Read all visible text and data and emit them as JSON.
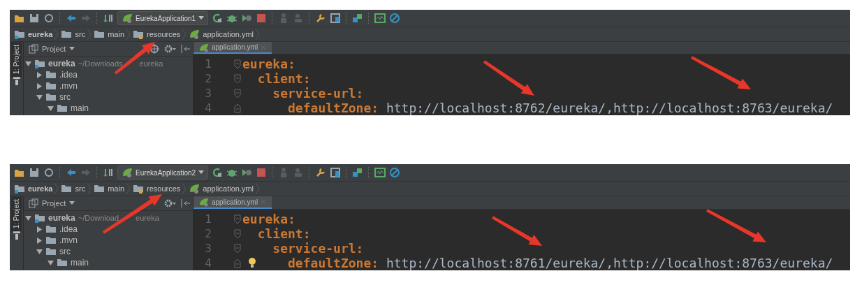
{
  "panels": [
    {
      "toolbar": {
        "run_config": "EurekaApplication1"
      },
      "breadcrumbs": [
        {
          "label": "eureka",
          "kind": "module"
        },
        {
          "label": "src",
          "kind": "folder"
        },
        {
          "label": "main",
          "kind": "folder"
        },
        {
          "label": "resources",
          "kind": "resources"
        },
        {
          "label": "application.yml",
          "kind": "yaml"
        }
      ],
      "tool_window": {
        "stripe_label": "1: Project",
        "title": "Project"
      },
      "pane_tools": [
        {
          "kind": "target"
        },
        {
          "kind": "gear"
        },
        {
          "kind": "collapse"
        }
      ],
      "tree": [
        {
          "label": "eureka",
          "path_parts": [
            "~/Downloads",
            "eureka"
          ],
          "kind": "module",
          "expanded": true,
          "children": [
            {
              "label": ".idea",
              "kind": "folder",
              "expanded": false
            },
            {
              "label": ".mvn",
              "kind": "folder",
              "expanded": false
            },
            {
              "label": "src",
              "kind": "folder",
              "expanded": true,
              "children": [
                {
                  "label": "main",
                  "kind": "folder",
                  "expanded": true
                }
              ]
            }
          ]
        }
      ],
      "editor": {
        "tab": {
          "label": "application.yml",
          "selected": true
        },
        "lightbulb": false,
        "lines": [
          {
            "number": "1",
            "key": "eureka:",
            "children": [
              {
                "number": "2",
                "key": "client:",
                "children": [
                  {
                    "number": "3",
                    "key": "service-url:",
                    "children": [
                      {
                        "number": "4",
                        "key": "defaultZone:",
                        "value": "http://localhost:8762/eureka/,http://localhost:8763/eureka/"
                      }
                    ]
                  }
                ]
              }
            ]
          }
        ]
      },
      "annotations": [
        {
          "kind": "arrow"
        },
        {
          "kind": "arrow"
        },
        {
          "kind": "arrow"
        }
      ]
    },
    {
      "toolbar": {
        "run_config": "EurekaApplication2"
      },
      "breadcrumbs": [
        {
          "label": "eureka",
          "kind": "module"
        },
        {
          "label": "src",
          "kind": "folder"
        },
        {
          "label": "main",
          "kind": "folder"
        },
        {
          "label": "resources",
          "kind": "resources"
        },
        {
          "label": "application.yml",
          "kind": "yaml"
        }
      ],
      "tool_window": {
        "stripe_label": "1: Project",
        "title": "Project"
      },
      "pane_tools": [
        {
          "kind": "gear"
        },
        {
          "kind": "collapse"
        }
      ],
      "tree": [
        {
          "label": "eureka",
          "path_parts": [
            "~/Download",
            "eureka"
          ],
          "kind": "module",
          "expanded": true,
          "children": [
            {
              "label": ".idea",
              "kind": "folder",
              "expanded": false
            },
            {
              "label": ".mvn",
              "kind": "folder",
              "expanded": false
            },
            {
              "label": "src",
              "kind": "folder",
              "expanded": true,
              "children": [
                {
                  "label": "main",
                  "kind": "folder",
                  "expanded": true
                }
              ]
            }
          ]
        }
      ],
      "editor": {
        "tab": {
          "label": "application.yml",
          "selected": true
        },
        "lightbulb": true,
        "lines": [
          {
            "number": "1",
            "key": "eureka:",
            "children": [
              {
                "number": "2",
                "key": "client:",
                "children": [
                  {
                    "number": "3",
                    "key": "service-url:",
                    "children": [
                      {
                        "number": "4",
                        "key": "defaultZone:",
                        "value": "http://localhost:8761/eureka/,http://localhost:8763/eureka/"
                      }
                    ]
                  }
                ]
              }
            ]
          }
        ]
      },
      "annotations": [
        {
          "kind": "arrow"
        },
        {
          "kind": "arrow"
        },
        {
          "kind": "arrow"
        }
      ]
    }
  ]
}
